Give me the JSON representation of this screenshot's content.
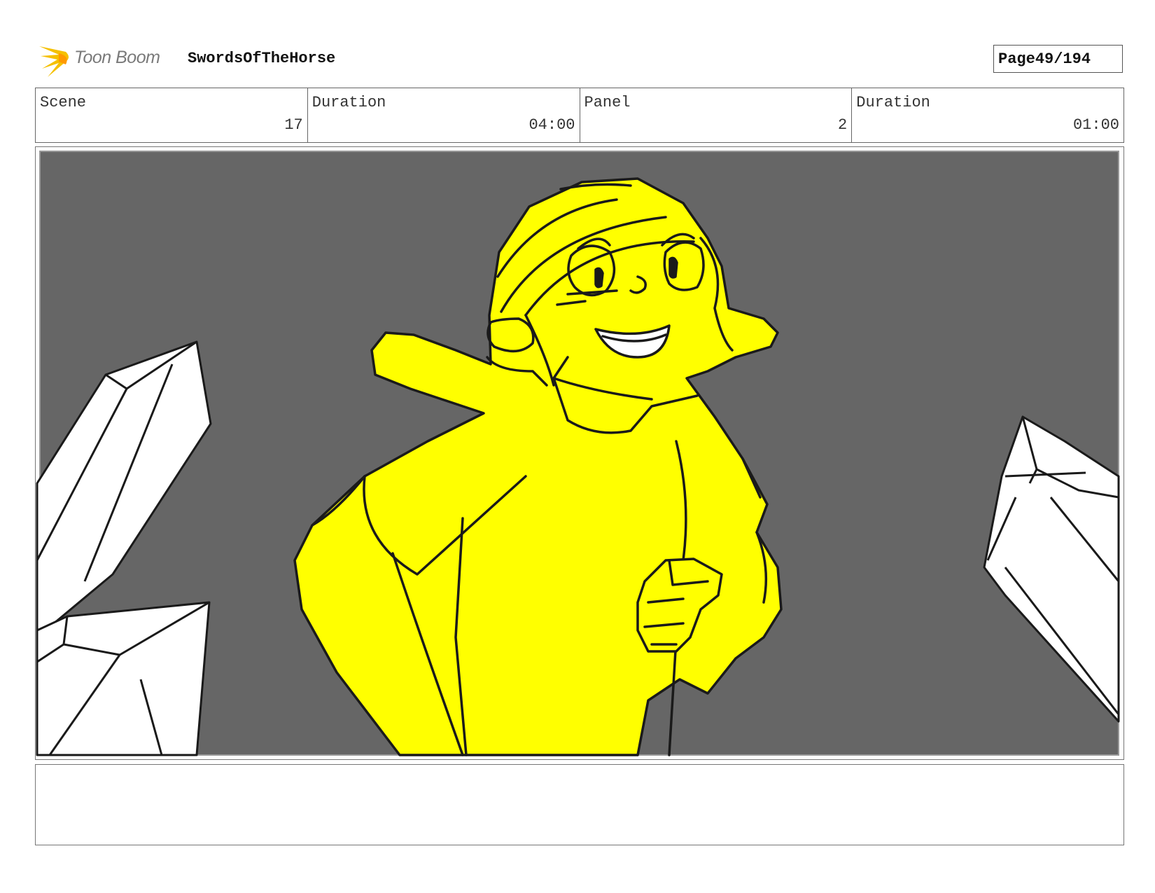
{
  "header": {
    "logo_text": "Toon Boom",
    "project_title": "SwordsOfTheHorse",
    "page_label": "Page",
    "page_value": "49/194"
  },
  "info": {
    "scene": {
      "label": "Scene",
      "value": "17"
    },
    "scene_duration": {
      "label": "Duration",
      "value": "04:00"
    },
    "panel": {
      "label": "Panel",
      "value": "2"
    },
    "panel_duration": {
      "label": "Duration",
      "value": "01:00"
    }
  },
  "panel_image": {
    "subject": "yellow-character",
    "background_color": "#666666",
    "character_color": "#ffff00",
    "crystal_color": "#ffffff",
    "line_color": "#1a1a1a"
  },
  "notes": {
    "text": ""
  },
  "colors": {
    "logo_accent": "#f5c000",
    "logo_text": "#7a7a7a"
  }
}
